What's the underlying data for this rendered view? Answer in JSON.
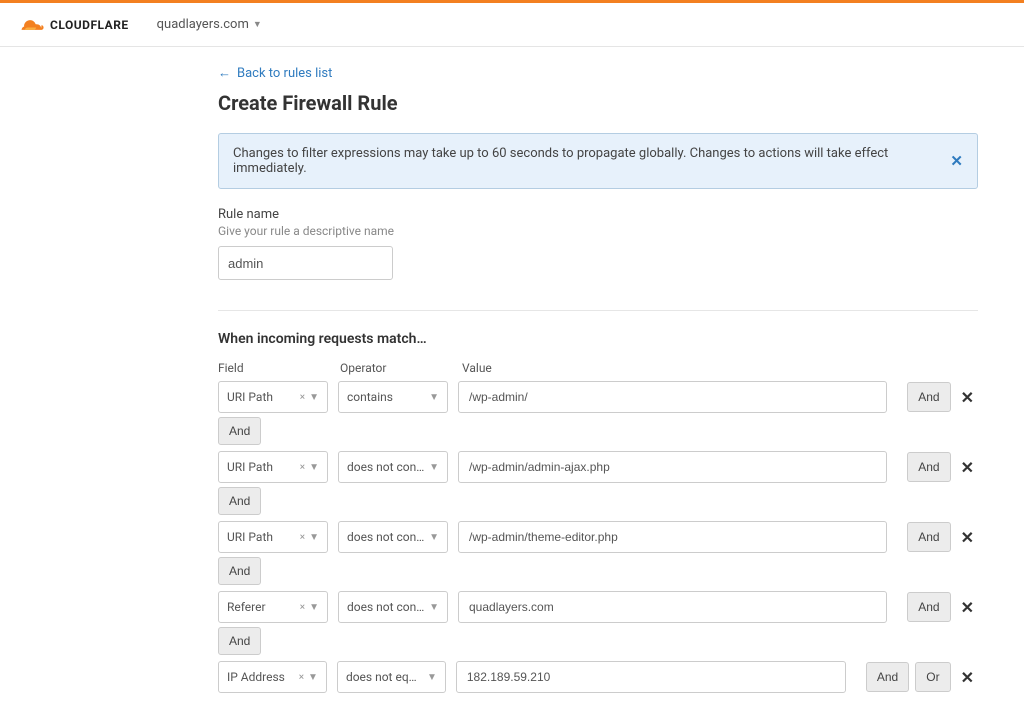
{
  "brand": "CLOUDFLARE",
  "domain_selector": "quadlayers.com",
  "backlink": "Back to rules list",
  "page_title": "Create Firewall Rule",
  "notice": "Changes to filter expressions may take up to 60 seconds to propagate globally. Changes to actions will take effect immediately.",
  "rule_name": {
    "label": "Rule name",
    "hint": "Give your rule a descriptive name",
    "value": "admin"
  },
  "matches_heading": "When incoming requests match…",
  "columns": {
    "field": "Field",
    "operator": "Operator",
    "value": "Value"
  },
  "rules": [
    {
      "field": "URI Path",
      "operator": "contains",
      "value": "/wp-admin/",
      "buttons": [
        "And"
      ],
      "connector_after": "And"
    },
    {
      "field": "URI Path",
      "operator": "does not cont...",
      "value": "/wp-admin/admin-ajax.php",
      "buttons": [
        "And"
      ],
      "connector_after": "And"
    },
    {
      "field": "URI Path",
      "operator": "does not cont...",
      "value": "/wp-admin/theme-editor.php",
      "buttons": [
        "And"
      ],
      "connector_after": "And"
    },
    {
      "field": "Referer",
      "operator": "does not cont...",
      "value": "quadlayers.com",
      "buttons": [
        "And"
      ],
      "connector_after": "And"
    },
    {
      "field": "IP Address",
      "operator": "does not equal",
      "value": "182.189.59.210",
      "buttons": [
        "And",
        "Or"
      ],
      "connector_after": null
    }
  ]
}
